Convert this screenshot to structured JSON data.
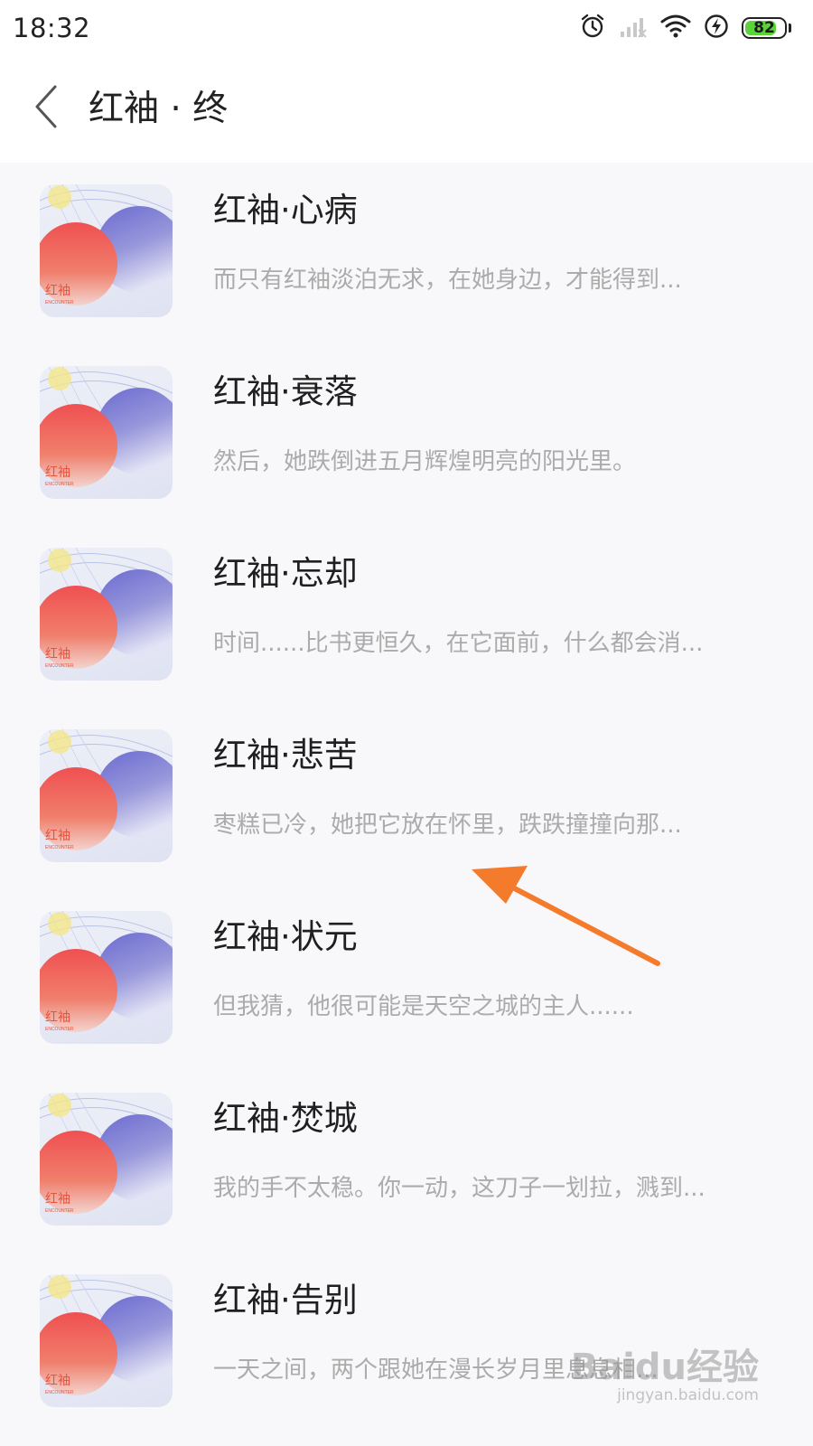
{
  "status_bar": {
    "time": "18:32",
    "battery": "82",
    "battery_level_percent": 82,
    "icons": [
      "alarm-icon",
      "signal-icon",
      "wifi-icon",
      "charging-icon",
      "battery-icon"
    ]
  },
  "header": {
    "back_icon": "chevron-left-icon",
    "title": "红袖 · 终"
  },
  "cover": {
    "label": "红袖",
    "sublabel": "ENCOUNTER"
  },
  "items": [
    {
      "title": "红袖·心病",
      "desc": "而只有红袖淡泊无求，在她身边，才能得到..."
    },
    {
      "title": "红袖·衰落",
      "desc": "然后，她跌倒进五月辉煌明亮的阳光里。"
    },
    {
      "title": "红袖·忘却",
      "desc": "时间......比书更恒久，在它面前，什么都会消..."
    },
    {
      "title": "红袖·悲苦",
      "desc": "枣糕已冷，她把它放在怀里，跌跌撞撞向那..."
    },
    {
      "title": "红袖·状元",
      "desc": "但我猜，他很可能是天空之城的主人......"
    },
    {
      "title": "红袖·焚城",
      "desc": "我的手不太稳。你一动，这刀子一划拉，溅到..."
    },
    {
      "title": "红袖·告别",
      "desc": "一天之间，两个跟她在漫长岁月里息息相..."
    }
  ],
  "watermark": {
    "main": "Baidu经验",
    "sub": "jingyan.baidu.com"
  },
  "colors": {
    "accent_arrow": "#f47a2c",
    "battery_green": "#5bd23a"
  }
}
